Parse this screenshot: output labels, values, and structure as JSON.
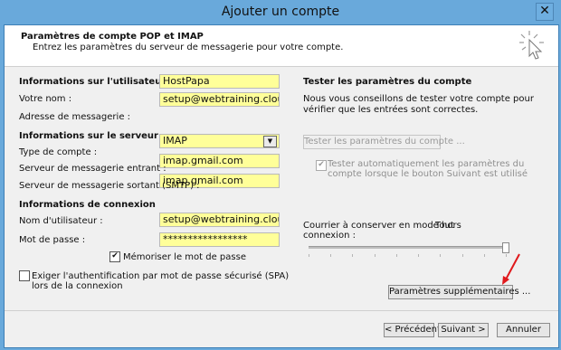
{
  "window": {
    "title": "Ajouter un compte",
    "close_glyph": "✕"
  },
  "header": {
    "title": "Paramètres de compte POP et IMAP",
    "subtitle": "Entrez les paramètres du serveur de messagerie pour votre compte."
  },
  "user_info": {
    "section": "Informations sur l'utilisateur",
    "name_label": "Votre nom :",
    "name_value": "HostPapa",
    "email_label": "Adresse de messagerie :",
    "email_value": "setup@webtraining.cloud"
  },
  "server_info": {
    "section": "Informations sur le serveur",
    "account_type_label": "Type de compte :",
    "account_type_value": "IMAP",
    "incoming_label": "Serveur de messagerie entrant :",
    "incoming_value": "imap.gmail.com",
    "outgoing_label": "Serveur de messagerie sortant (SMTP) :",
    "outgoing_value": "imap.gmail.com"
  },
  "login_info": {
    "section": "Informations de connexion",
    "username_label": "Nom d'utilisateur :",
    "username_value": "setup@webtraining.cloud",
    "password_label": "Mot de passe :",
    "password_value": "*****************",
    "remember_label": "Mémoriser le mot de passe",
    "remember_checked": true,
    "spa_label_line1": "Exiger l'authentification par mot de passe sécurisé (SPA)",
    "spa_label_line2": "lors de la connexion",
    "spa_checked": false
  },
  "test": {
    "section": "Tester les paramètres du compte",
    "text_line1": "Nous vous conseillons de tester votre compte pour",
    "text_line2": "vérifier que les entrées sont correctes.",
    "test_button": "Tester les paramètres du compte ...",
    "auto_label_line1": "Tester automatiquement les paramètres du",
    "auto_label_line2": "compte lorsque le bouton Suivant est utilisé",
    "auto_checked": true
  },
  "offline": {
    "label_line1": "Courrier à conserver en mode hors",
    "label_line2": "connexion :",
    "value": "Tout",
    "slider_level": 1.0
  },
  "more_settings_button": "Paramètres supplémentaires ...",
  "footer": {
    "prev": "< Précédent",
    "next": "Suivant >",
    "cancel": "Annuler"
  },
  "colors": {
    "field_bg": "#ffff99",
    "title_bar": "#69a9db",
    "annotation_arrow": "#e0191c"
  }
}
